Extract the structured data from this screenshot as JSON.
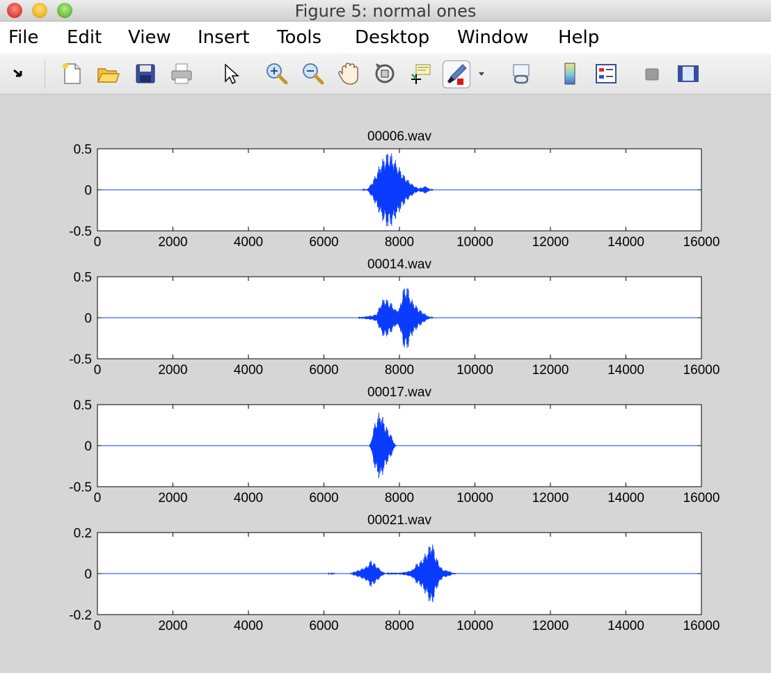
{
  "window": {
    "title": "Figure 5: normal ones"
  },
  "menu": {
    "items": [
      "File",
      "Edit",
      "View",
      "Insert",
      "Tools",
      "Desktop",
      "Window",
      "Help"
    ]
  },
  "toolbar": {
    "buttons": [
      "arrow-icon",
      "new-figure-icon",
      "open-file-icon",
      "save-icon",
      "print-icon",
      "select-pointer-icon",
      "zoom-in-icon",
      "zoom-out-icon",
      "pan-hand-icon",
      "rotate-3d-icon",
      "data-cursor-icon",
      "brush-icon",
      "dropdown-arrow-icon",
      "link-plot-icon",
      "colorbar-icon",
      "legend-icon",
      "hide-plot-tools-icon",
      "show-plot-tools-icon"
    ]
  },
  "colors": {
    "signal": "#0a3cff",
    "axes_bg": "#ffffff",
    "figure_bg": "#d6d6d6"
  },
  "chart_data": [
    {
      "type": "line",
      "title": "00006.wav",
      "xlim": [
        0,
        16000
      ],
      "ylim": [
        -0.5,
        0.5
      ],
      "xticks": [
        0,
        2000,
        4000,
        6000,
        8000,
        10000,
        12000,
        14000,
        16000
      ],
      "yticks": [
        -0.5,
        0,
        0.5
      ],
      "ytick_labels": [
        "-0.5",
        "0",
        "0.5"
      ],
      "envelope": [
        [
          0,
          0
        ],
        [
          7000,
          0
        ],
        [
          7150,
          0.01
        ],
        [
          7200,
          0.04
        ],
        [
          7300,
          0.12
        ],
        [
          7400,
          0.22
        ],
        [
          7500,
          0.34
        ],
        [
          7600,
          0.42
        ],
        [
          7700,
          0.48
        ],
        [
          7800,
          0.45
        ],
        [
          7900,
          0.36
        ],
        [
          8000,
          0.28
        ],
        [
          8100,
          0.2
        ],
        [
          8200,
          0.14
        ],
        [
          8300,
          0.09
        ],
        [
          8400,
          0.05
        ],
        [
          8500,
          0.02
        ],
        [
          8600,
          0.03
        ],
        [
          8700,
          0.05
        ],
        [
          8800,
          0.01
        ],
        [
          8900,
          0
        ],
        [
          16000,
          0
        ]
      ]
    },
    {
      "type": "line",
      "title": "00014.wav",
      "xlim": [
        0,
        16000
      ],
      "ylim": [
        -0.5,
        0.5
      ],
      "xticks": [
        0,
        2000,
        4000,
        6000,
        8000,
        10000,
        12000,
        14000,
        16000
      ],
      "yticks": [
        -0.5,
        0,
        0.5
      ],
      "ytick_labels": [
        "-0.5",
        "0",
        "0.5"
      ],
      "envelope": [
        [
          0,
          0
        ],
        [
          6900,
          0
        ],
        [
          7000,
          0.01
        ],
        [
          7150,
          0.02
        ],
        [
          7300,
          0.03
        ],
        [
          7400,
          0.05
        ],
        [
          7500,
          0.18
        ],
        [
          7600,
          0.26
        ],
        [
          7700,
          0.22
        ],
        [
          7800,
          0.18
        ],
        [
          7900,
          0.1
        ],
        [
          8000,
          0.12
        ],
        [
          8100,
          0.36
        ],
        [
          8200,
          0.42
        ],
        [
          8300,
          0.25
        ],
        [
          8400,
          0.18
        ],
        [
          8500,
          0.12
        ],
        [
          8600,
          0.08
        ],
        [
          8700,
          0.04
        ],
        [
          8800,
          0.01
        ],
        [
          8900,
          0
        ],
        [
          16000,
          0
        ]
      ]
    },
    {
      "type": "line",
      "title": "00017.wav",
      "xlim": [
        0,
        16000
      ],
      "ylim": [
        -0.5,
        0.5
      ],
      "xticks": [
        0,
        2000,
        4000,
        6000,
        8000,
        10000,
        12000,
        14000,
        16000
      ],
      "yticks": [
        -0.5,
        0,
        0.5
      ],
      "ytick_labels": [
        "-0.5",
        "0",
        "0.5"
      ],
      "envelope": [
        [
          0,
          0
        ],
        [
          7200,
          0
        ],
        [
          7250,
          0.05
        ],
        [
          7300,
          0.2
        ],
        [
          7400,
          0.36
        ],
        [
          7500,
          0.44
        ],
        [
          7600,
          0.3
        ],
        [
          7700,
          0.2
        ],
        [
          7800,
          0.12
        ],
        [
          7850,
          0.05
        ],
        [
          7900,
          0
        ],
        [
          16000,
          0
        ]
      ]
    },
    {
      "type": "line",
      "title": "00021.wav",
      "xlim": [
        0,
        16000
      ],
      "ylim": [
        -0.2,
        0.2
      ],
      "xticks": [
        0,
        2000,
        4000,
        6000,
        8000,
        10000,
        12000,
        14000,
        16000
      ],
      "yticks": [
        -0.2,
        0,
        0.2
      ],
      "ytick_labels": [
        "-0.2",
        "0",
        "0.2"
      ],
      "envelope": [
        [
          0,
          0
        ],
        [
          6100,
          0
        ],
        [
          6200,
          0.005
        ],
        [
          6300,
          0
        ],
        [
          6700,
          0
        ],
        [
          6800,
          0.01
        ],
        [
          6950,
          0.02
        ],
        [
          7050,
          0.03
        ],
        [
          7150,
          0.04
        ],
        [
          7250,
          0.07
        ],
        [
          7350,
          0.05
        ],
        [
          7450,
          0.03
        ],
        [
          7550,
          0.01
        ],
        [
          7650,
          0
        ],
        [
          7800,
          0.005
        ],
        [
          8000,
          0.004
        ],
        [
          8200,
          0.01
        ],
        [
          8350,
          0.02
        ],
        [
          8450,
          0.05
        ],
        [
          8550,
          0.06
        ],
        [
          8650,
          0.09
        ],
        [
          8750,
          0.12
        ],
        [
          8850,
          0.17
        ],
        [
          8950,
          0.1
        ],
        [
          9050,
          0.05
        ],
        [
          9150,
          0.02
        ],
        [
          9300,
          0.015
        ],
        [
          9400,
          0.005
        ],
        [
          9500,
          0
        ],
        [
          16000,
          0
        ]
      ]
    }
  ]
}
